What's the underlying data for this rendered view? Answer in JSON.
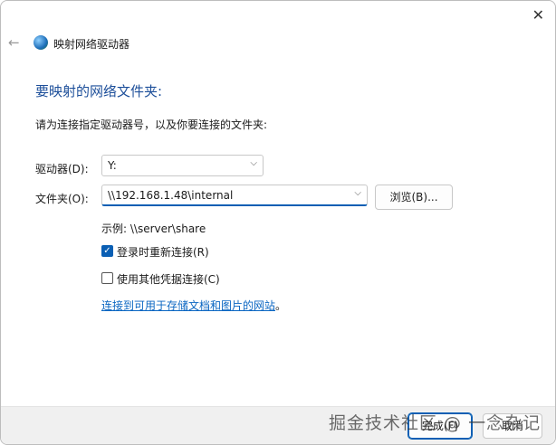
{
  "window": {
    "title": "映射网络驱动器",
    "close_icon": "close-icon",
    "back_icon": "back-arrow-icon"
  },
  "heading": "要映射的网络文件夹:",
  "instruction": "请为连接指定驱动器号，以及你要连接的文件夹:",
  "drive": {
    "label": "驱动器(D):",
    "value": "Y:"
  },
  "folder": {
    "label": "文件夹(O):",
    "value": "\\\\192.168.1.48\\internal",
    "browse_label": "浏览(B)..."
  },
  "example": "示例: \\\\server\\share",
  "reconnect": {
    "label": "登录时重新连接(R)",
    "checked": true
  },
  "other_creds": {
    "label": "使用其他凭据连接(C)",
    "checked": false
  },
  "link": "连接到可用于存储文档和图片的网站",
  "link_suffix": "。",
  "footer": {
    "finish_label": "完成(F)",
    "cancel_label": "取消"
  },
  "watermark": "掘金技术社区 @ 一念杂记",
  "colors": {
    "accent": "#0a5fb4",
    "heading": "#1d4f9a",
    "link": "#0a66c2"
  }
}
